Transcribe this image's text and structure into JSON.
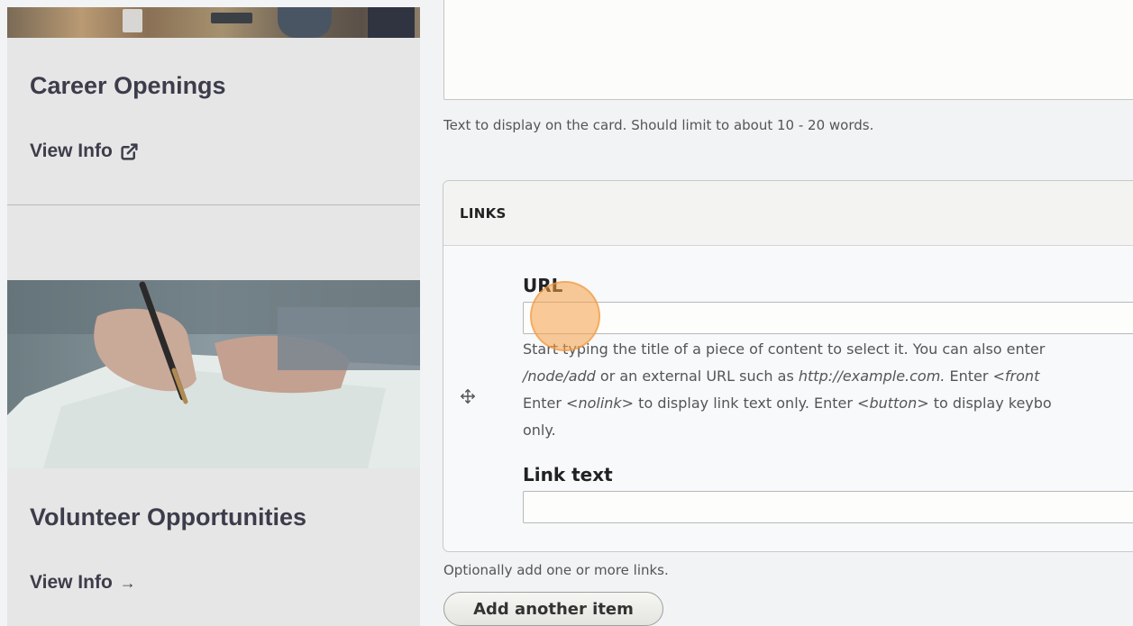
{
  "left_panel": {
    "cards": [
      {
        "title": "Career Openings",
        "link_label": "View Info",
        "link_icon": "external-link-icon"
      },
      {
        "title": "Volunteer Opportunities",
        "link_label": "View Info",
        "link_icon": "arrow-right-icon",
        "link_arrow": "→"
      }
    ]
  },
  "form": {
    "summary_help": "Text to display on the card. Should limit to about 10 - 20 words.",
    "links_fieldset": {
      "legend": "LINKS",
      "url_label": "URL",
      "url_value": "",
      "url_help": {
        "l1": "Start typing the title of a piece of content to select it. You can also enter",
        "l2a": "/node/add",
        "l2b": " or an external URL such as ",
        "l2c": "http://example.com.",
        "l2d": " Enter ",
        "l2e": "<front",
        "l3a": "Enter ",
        "l3b": "<nolink>",
        "l3c": " to display link text only. Enter ",
        "l3d": "<button>",
        "l3e": " to display keybo",
        "l4": "only."
      },
      "link_text_label": "Link text",
      "link_text_value": ""
    },
    "links_help": "Optionally add one or more links.",
    "add_item_label": "Add another item"
  },
  "colors": {
    "panel_bg": "#e6e6e7",
    "heading": "#3c3d4a",
    "cursor_highlight": "#f5a046"
  }
}
